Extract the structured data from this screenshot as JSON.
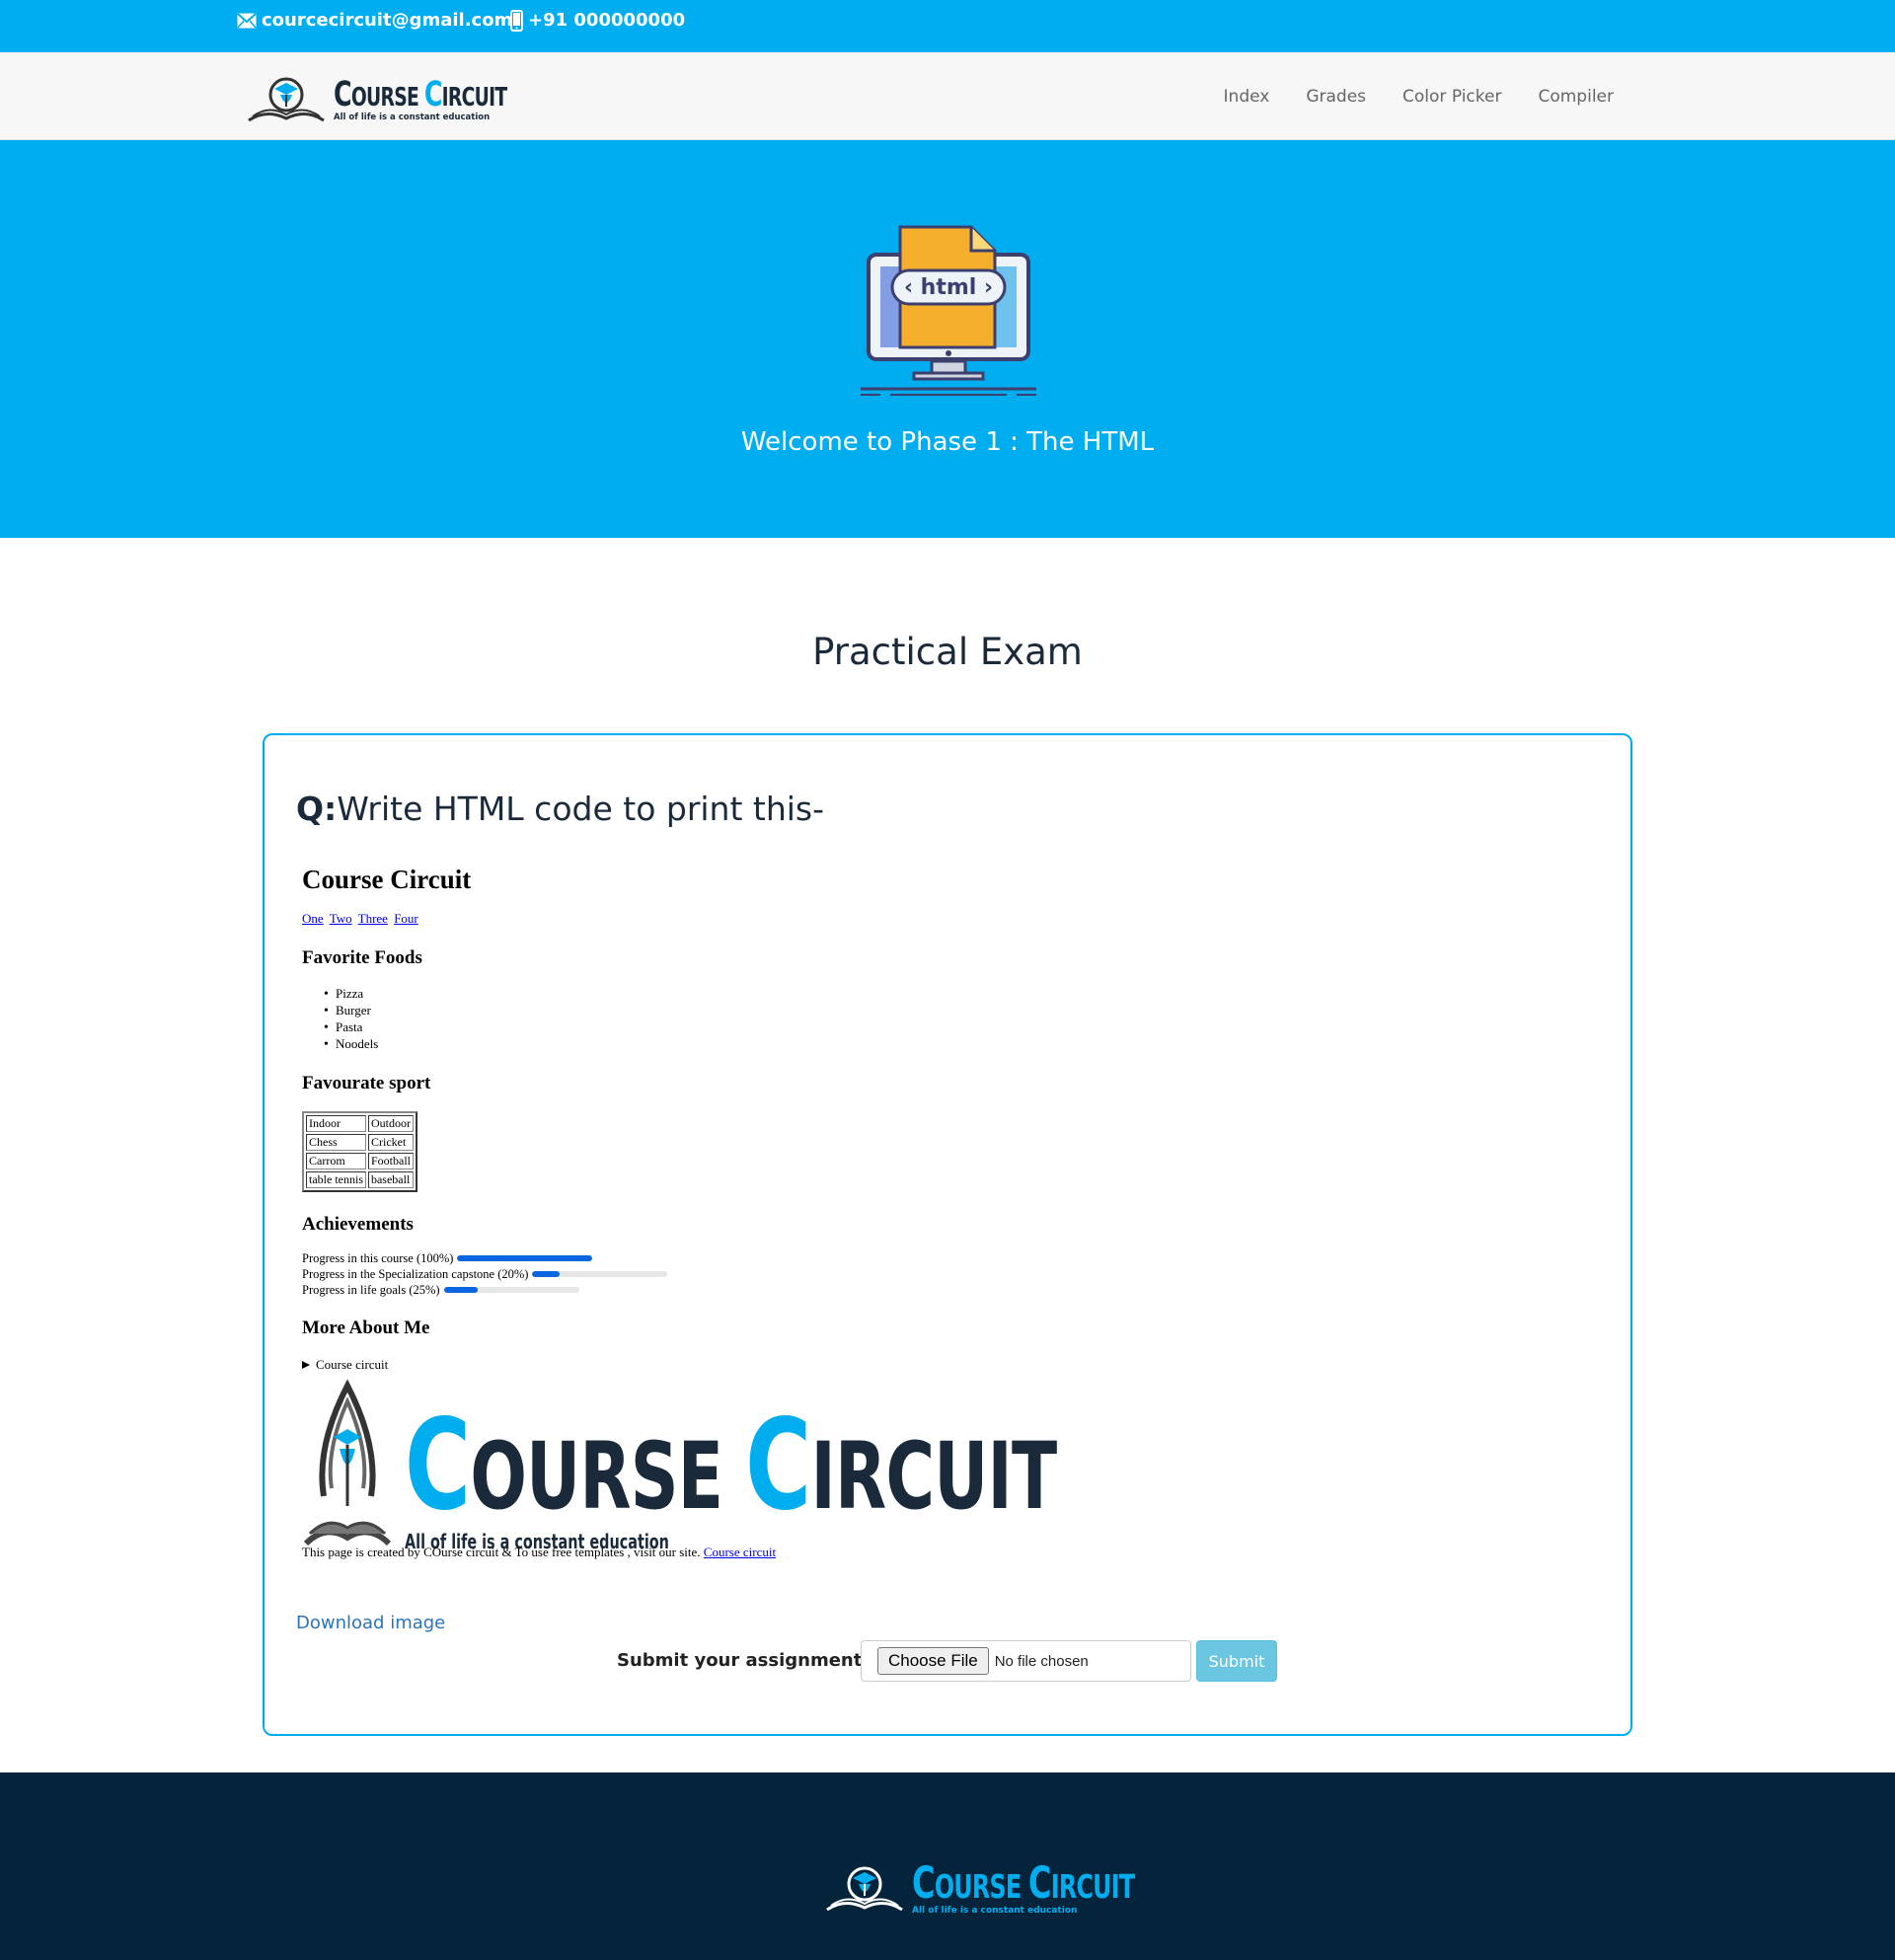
{
  "topbar": {
    "email": "courcecircuit@gmail.com",
    "phone": "+91 000000000",
    "email_icon": "envelope-icon",
    "phone_icon": "mobile-phone-icon"
  },
  "brand": {
    "name_part1_initial": "C",
    "name_part1_rest": "OURSE",
    "name_part2_initial": "C",
    "name_part2_rest": "IRCUIT",
    "tagline": "All of life is a constant education",
    "accent_color": "#00aeef"
  },
  "nav": {
    "items": [
      "Index",
      "Grades",
      "Color Picker",
      "Compiler"
    ]
  },
  "hero": {
    "title": "Welcome to Phase 1 : The HTML",
    "icon_label": "html",
    "background_color": "#00aeef"
  },
  "exam": {
    "title": "Practical Exam",
    "question_prefix": "Q:",
    "question_text": "Write HTML code to print this-",
    "sample": {
      "heading": "Course Circuit",
      "links": [
        "One",
        "Two",
        "Three",
        "Four"
      ],
      "foods_heading": "Favorite Foods",
      "foods": [
        "Pizza",
        "Burger",
        "Pasta",
        "Noodels"
      ],
      "sport_heading": "Favourate sport",
      "sport_table": [
        [
          "Indoor",
          "Outdoor"
        ],
        [
          "Chess",
          "Cricket"
        ],
        [
          "Carrom",
          "Football"
        ],
        [
          "table tennis",
          "baseball"
        ]
      ],
      "achievements_heading": "Achievements",
      "progress": [
        {
          "label": "Progress in this course (100%)",
          "value": 100
        },
        {
          "label": "Progress in the Specialization capstone (20%)",
          "value": 20
        },
        {
          "label": "Progress in life goals (25%)",
          "value": 25
        }
      ],
      "more_heading": "More About Me",
      "details_summary": "Course circuit",
      "footer_text": "This page is created by COurse circuit & To use free templates , visit our site.",
      "footer_link": "Course circuit"
    },
    "download_link": "Download image",
    "submit_label": "Submit your assignment:",
    "file_button": "Choose File",
    "file_status": "No file chosen",
    "submit_button": "Submit"
  },
  "footer": {
    "background_color": "#03243a"
  }
}
